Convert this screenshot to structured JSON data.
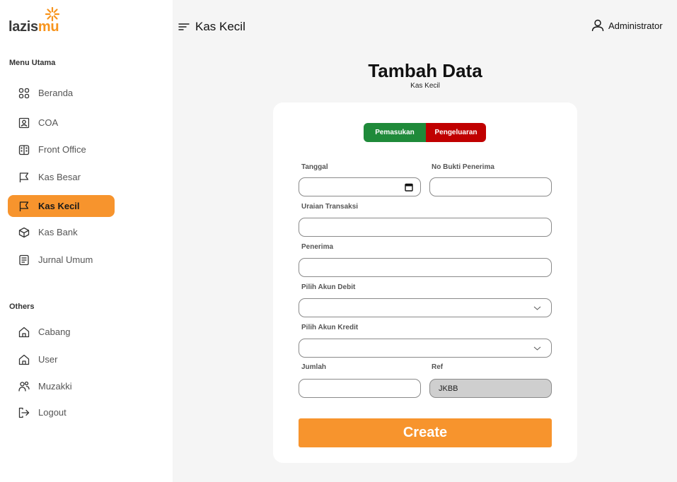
{
  "logo": {
    "part1": "lazis",
    "part2": "mu"
  },
  "sidebar": {
    "section_main": "Menu Utama",
    "section_others": "Others",
    "main_items": [
      {
        "label": "Beranda",
        "icon": "grid-icon"
      },
      {
        "label": "COA",
        "icon": "id-card-icon"
      },
      {
        "label": "Front Office",
        "icon": "building-icon"
      },
      {
        "label": "Kas Besar",
        "icon": "flag-icon"
      },
      {
        "label": "Kas Kecil",
        "icon": "flag-icon",
        "active": true
      },
      {
        "label": "Kas Bank",
        "icon": "cube-icon"
      },
      {
        "label": "Jurnal Umum",
        "icon": "document-icon"
      }
    ],
    "other_items": [
      {
        "label": "Cabang",
        "icon": "home-icon"
      },
      {
        "label": "User",
        "icon": "home-icon"
      },
      {
        "label": "Muzakki",
        "icon": "users-icon"
      },
      {
        "label": "Logout",
        "icon": "logout-icon"
      }
    ]
  },
  "header": {
    "title": "Kas Kecil",
    "user": "Administrator"
  },
  "main": {
    "title": "Tambah Data",
    "subtitle": "Kas Kecil"
  },
  "form": {
    "toggle": {
      "income": "Pemasukan",
      "expense": "Pengeluaran"
    },
    "tanggal_label": "Tanggal",
    "tanggal_value": "",
    "no_bukti_label": "No Bukti Penerima",
    "no_bukti_value": "",
    "uraian_label": "Uraian Transaksi",
    "uraian_value": "",
    "penerima_label": "Penerima",
    "penerima_value": "",
    "debit_label": "Pilih Akun Debit",
    "debit_value": "",
    "kredit_label": "Pilih Akun Kredit",
    "kredit_value": "",
    "jumlah_label": "Jumlah",
    "jumlah_value": "",
    "ref_label": "Ref",
    "ref_value": "JKBB",
    "submit": "Create"
  },
  "colors": {
    "accent": "#f7942d",
    "income": "#1f8a3a",
    "expense": "#c00000"
  }
}
